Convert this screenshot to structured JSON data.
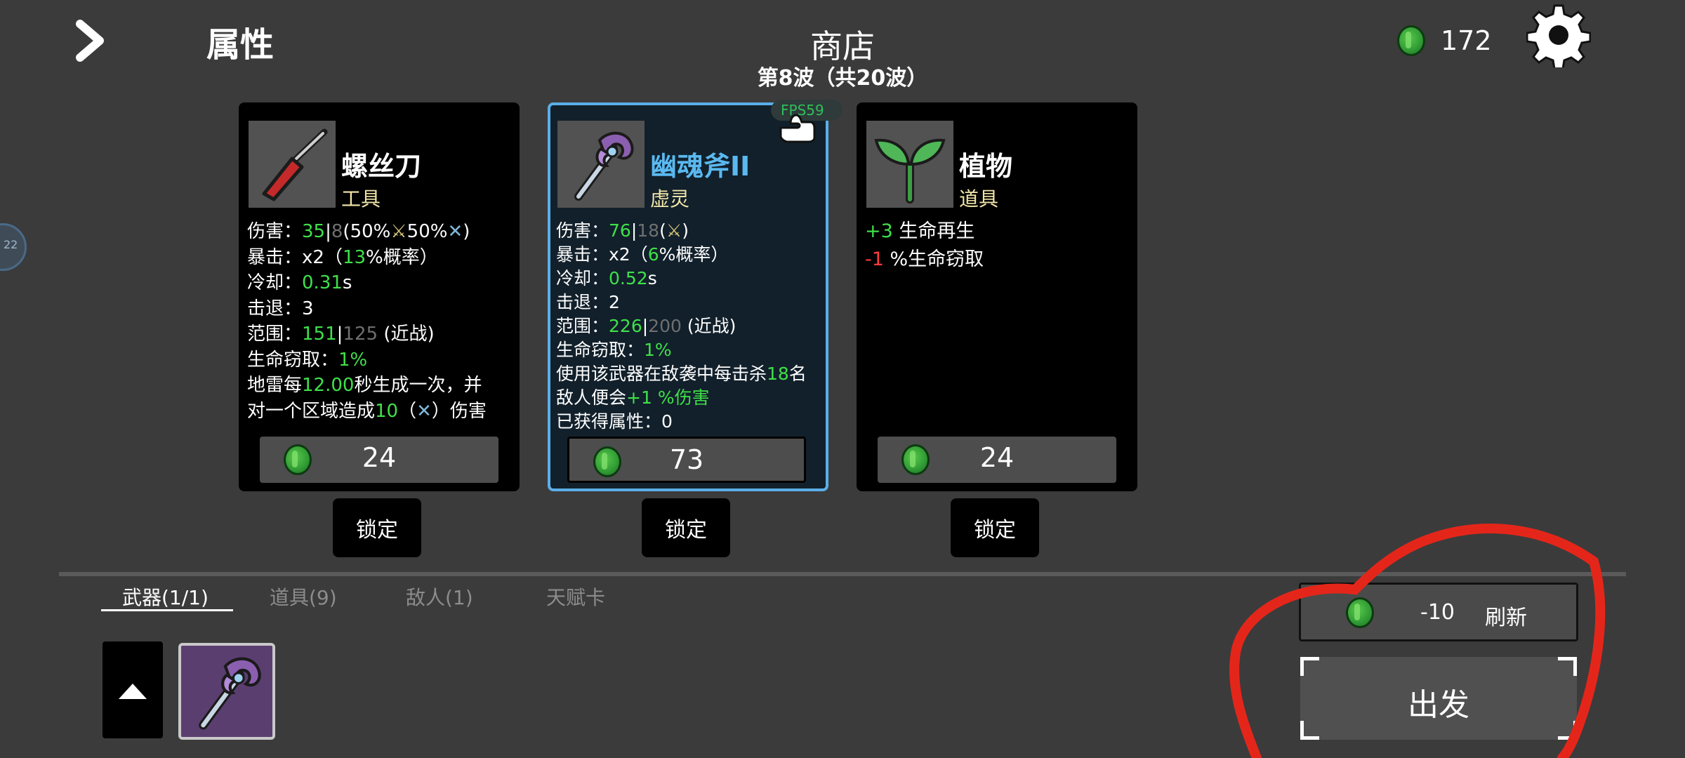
{
  "header": {
    "attributes_label": "属性",
    "shop_title": "商店",
    "wave_label": "第8波（共20波）",
    "currency_amount": "172",
    "fps_label": "FPS59"
  },
  "side_tab_label": "22",
  "cards": [
    {
      "name": "螺丝刀",
      "type": "工具",
      "price": "24",
      "lock_label": "锁定",
      "stats": {
        "damage_label": "伤害：",
        "damage_val": "35",
        "damage_base": "8",
        "damage_pct1": "(50%",
        "damage_pct2": "50%",
        "damage_close": ")",
        "crit_label": "暴击：",
        "crit_mult": "x2（",
        "crit_val": "13",
        "crit_suffix": "%概率）",
        "cooldown_label": "冷却：",
        "cooldown_val": "0.31",
        "cooldown_unit": "s",
        "knockback_label": "击退：",
        "knockback_val": "3",
        "range_label": "范围：",
        "range_val": "151",
        "range_base": "125",
        "range_suffix": " (近战)",
        "lifesteal_label": "生命窃取：",
        "lifesteal_val": "1%",
        "mine_prefix": "地雷每",
        "mine_time": "12.00",
        "mine_mid": "秒生成一次，并",
        "mine_prefix2": "对一个区域造成",
        "mine_dmg": "10",
        "mine_open": "（",
        "mine_close": "）伤害"
      }
    },
    {
      "name": "幽魂斧II",
      "type": "虚灵",
      "price": "73",
      "lock_label": "锁定",
      "stats": {
        "damage_label": "伤害：",
        "damage_val": "76",
        "damage_base": "18",
        "damage_open": "(",
        "damage_close": ")",
        "crit_label": "暴击：",
        "crit_mult": "x2（",
        "crit_val": "6",
        "crit_suffix": "%概率）",
        "cooldown_label": "冷却：",
        "cooldown_val": "0.52",
        "cooldown_unit": "s",
        "knockback_label": "击退：",
        "knockback_val": "2",
        "range_label": "范围：",
        "range_val": "226",
        "range_base": "200",
        "range_suffix": " (近战)",
        "lifesteal_label": "生命窃取：",
        "lifesteal_val": "1%",
        "kill_prefix": "使用该武器在敌袭中每击杀",
        "kill_count": "18",
        "kill_suffix": "名",
        "kill_prefix2": "敌人便会",
        "kill_bonus": "+1 %伤害",
        "gained_label": "已获得属性：",
        "gained_val": "0"
      }
    },
    {
      "name": "植物",
      "type": "道具",
      "price": "24",
      "lock_label": "锁定",
      "stats": {
        "regen_val": "+3",
        "regen_label": " 生命再生",
        "lifesteal_val": "-1",
        "lifesteal_label": " %生命窃取"
      }
    }
  ],
  "tabs": [
    "武器(1/1)",
    "道具(9)",
    "敌人(1)",
    "天赋卡"
  ],
  "refresh": {
    "cost": "-10",
    "label": "刷新"
  },
  "go_label": "出发",
  "colors": {
    "positive": "#3fe04a",
    "negative": "#ff3b3b",
    "selected_border": "#5aaee8",
    "selected_name": "#5ab9f0"
  }
}
